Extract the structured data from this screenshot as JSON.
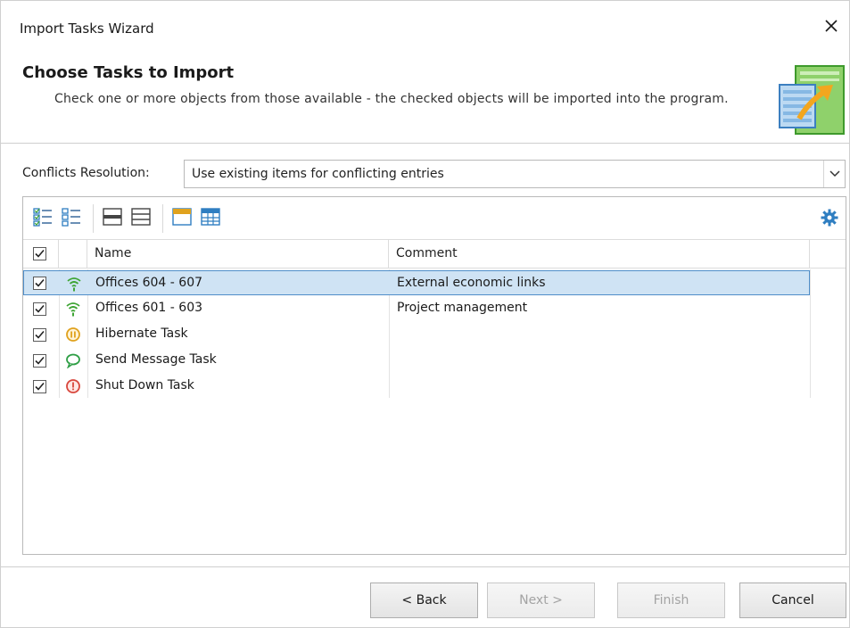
{
  "window": {
    "title": "Import Tasks Wizard",
    "close_glyph": "✕"
  },
  "header": {
    "title": "Choose Tasks to Import",
    "description": "Check one or more objects from those available - the checked objects will be imported into the program.",
    "icon": "import-spreadsheet-arrow-icon"
  },
  "conflicts": {
    "label": "Conflicts Resolution:",
    "value": "Use existing items for conflicting entries"
  },
  "toolbar": {
    "icons": [
      "check-all-icon",
      "uncheck-all-icon",
      "expand-rows-icon",
      "collapse-rows-icon",
      "show-header-icon",
      "show-grid-icon",
      "gear-icon"
    ]
  },
  "grid": {
    "columns": [
      "Name",
      "Comment"
    ],
    "rows": [
      {
        "name": "Offices 604 - 607",
        "comment": "External economic links",
        "checked": true,
        "icon": "wifi-icon",
        "selected": true
      },
      {
        "name": "Offices 601 - 603",
        "comment": "Project management",
        "checked": true,
        "icon": "wifi-icon",
        "selected": false
      },
      {
        "name": "Hibernate Task",
        "comment": "",
        "checked": true,
        "icon": "pause-icon",
        "selected": false
      },
      {
        "name": "Send Message Task",
        "comment": "",
        "checked": true,
        "icon": "message-icon",
        "selected": false
      },
      {
        "name": "Shut Down Task",
        "comment": "",
        "checked": true,
        "icon": "power-icon",
        "selected": false
      }
    ]
  },
  "buttons": {
    "back": "< Back",
    "next": "Next >",
    "finish": "Finish",
    "cancel": "Cancel"
  },
  "colors": {
    "selection_bg": "#cfe3f4",
    "selection_border": "#4f8ec9",
    "wifi_green": "#3fa535",
    "pause_orange": "#e0a21e",
    "message_green": "#2e9e45",
    "power_red": "#d8463c",
    "accent_blue": "#2f7ec1"
  }
}
